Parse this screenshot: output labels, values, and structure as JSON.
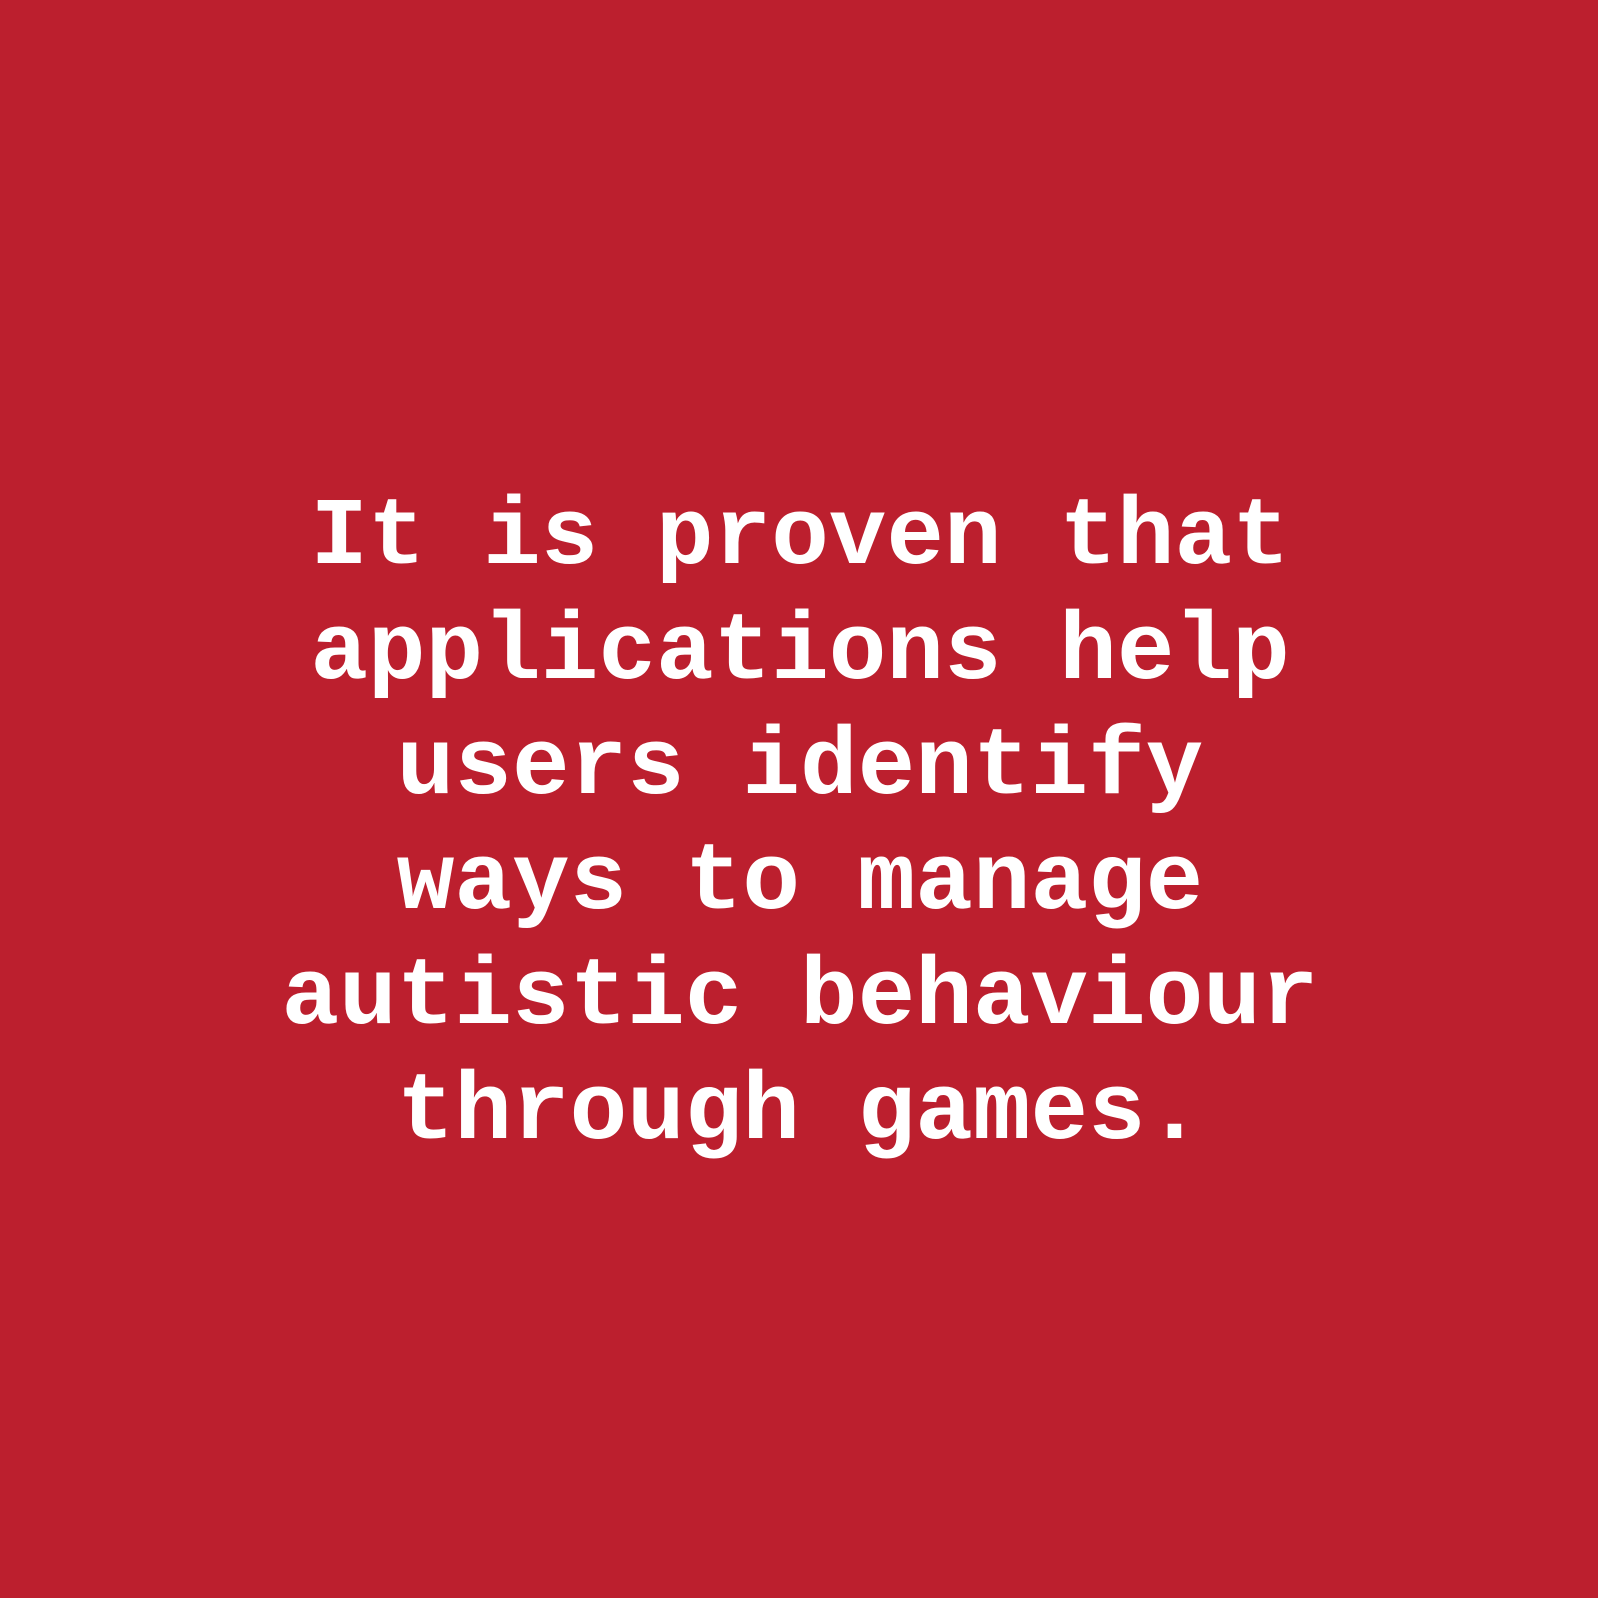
{
  "background_color": "#BC1F2E",
  "text_color": "#FFFFFF",
  "quote": {
    "lines": [
      "It is proven that",
      "applications help",
      "users identify",
      "ways to manage",
      "autistic behaviour",
      "through games."
    ]
  }
}
